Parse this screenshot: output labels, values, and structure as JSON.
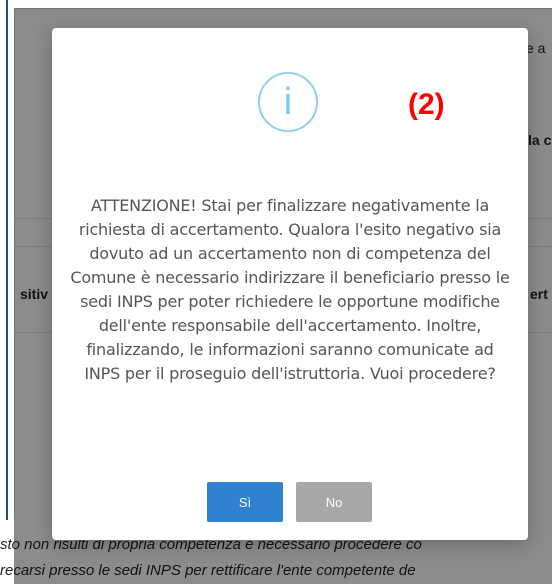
{
  "background": {
    "top_right_fragment": "e a",
    "bold_fragment_right": "la c",
    "left_bold_fragment": "sitiv",
    "right_bold_fragment": "ert",
    "bottom_line_1": "sto non risulti di propria competenza è necessario procedere co",
    "bottom_line_2": "recarsi presso le sedi INPS per rettificare l'ente competente de"
  },
  "modal": {
    "icon": "info-icon",
    "icon_glyph": "i",
    "step_label": "(2)",
    "message": "ATTENZIONE! Stai per finalizzare negativamente la richiesta di accertamento. Qualora l'esito negativo sia dovuto ad un accertamento non di competenza del Comune è necessario indirizzare il beneficiario presso le sedi INPS per poter richiedere le opportune modifiche dell'ente responsabile dell'accertamento. Inoltre, finalizzando, le informazioni saranno comunicate ad INPS per il proseguio dell'istruttoria. Vuoi procedere?",
    "yes_label": "Sì",
    "no_label": "No"
  },
  "colors": {
    "primary": "#2f82d0",
    "secondary": "#a8a8a8",
    "icon": "#8fd0f0",
    "step_label": "#ff0000"
  }
}
